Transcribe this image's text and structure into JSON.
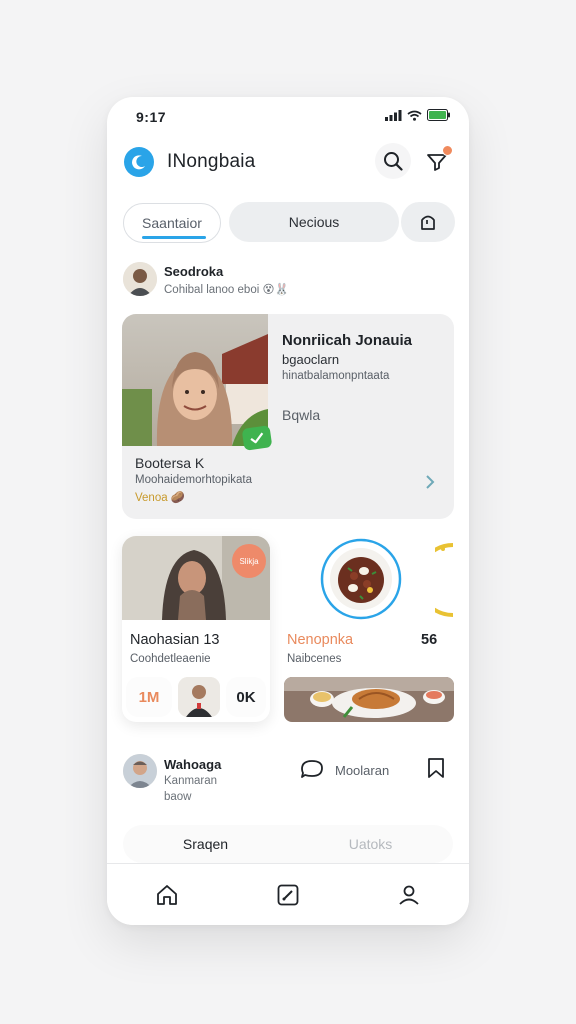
{
  "status": {
    "time": "9:17"
  },
  "header": {
    "app_title": "INongbaia"
  },
  "tabs": [
    {
      "label": "Saantaior"
    },
    {
      "label": "Necious"
    }
  ],
  "author": {
    "name": "Seodroka",
    "subtitle": "Cohibal lanoo eboi 😵🐰"
  },
  "featured": {
    "title": "Nonriicah Jonauia",
    "line2": "bgaoclarn",
    "line3": "hinatbalamonpntaata",
    "line4": "Bqwla",
    "footer_name": "Bootersa K",
    "footer_sub": "Moohaidemorhtopikata",
    "footer_tag": "Venoa 🥔"
  },
  "small_card": {
    "badge": "Slikja",
    "title": "Naohasian 13",
    "subtitle": "Coohdetleaenie",
    "stat1": "1M",
    "stat2": "0K"
  },
  "food": {
    "title": "Nenopnka",
    "count": "56",
    "subtitle": "Naibcenes"
  },
  "comment": {
    "name": "Wahoaga",
    "line1": "Kanmaran",
    "line2": "baow",
    "action_label": "Moolaran"
  },
  "bottom_tabs": {
    "left": "Sraqen",
    "right": "Uatoks"
  },
  "colors": {
    "accent": "#2aa4e8",
    "orange": "#e98a5d",
    "green": "#3fb34f"
  }
}
